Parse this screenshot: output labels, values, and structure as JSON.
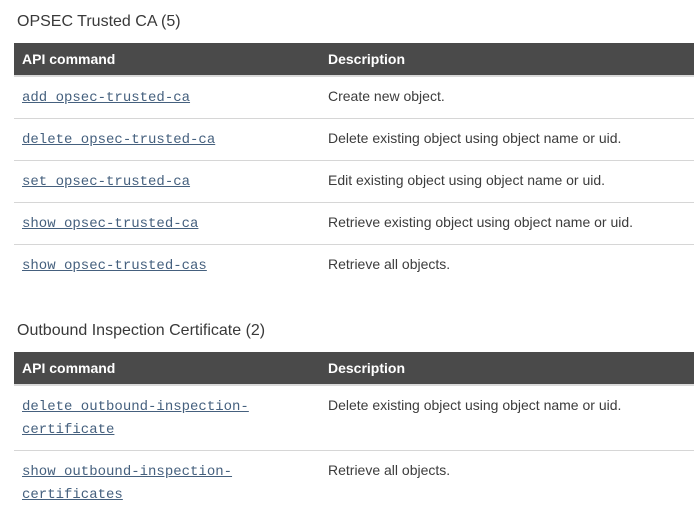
{
  "colors": {
    "header_background": "#4a4a4a",
    "header_text": "#ffffff",
    "link": "#45607e",
    "body_text": "#3c3c3c",
    "row_border": "#d6d6d6",
    "page_background": "#ffffff"
  },
  "sections": [
    {
      "title": "OPSEC Trusted CA (5)",
      "columns": [
        "API command",
        "Description"
      ],
      "rows": [
        {
          "command": "add opsec-trusted-ca",
          "description": "Create new object."
        },
        {
          "command": "delete opsec-trusted-ca",
          "description": "Delete existing object using object name or uid."
        },
        {
          "command": "set opsec-trusted-ca",
          "description": "Edit existing object using object name or uid."
        },
        {
          "command": "show opsec-trusted-ca",
          "description": "Retrieve existing object using object name or uid."
        },
        {
          "command": "show opsec-trusted-cas",
          "description": "Retrieve all objects."
        }
      ]
    },
    {
      "title": "Outbound Inspection Certificate (2)",
      "columns": [
        "API command",
        "Description"
      ],
      "rows": [
        {
          "command": "delete outbound-inspection-certificate",
          "description": "Delete existing object using object name or uid."
        },
        {
          "command": "show outbound-inspection-certificates",
          "description": "Retrieve all objects."
        }
      ]
    }
  ]
}
